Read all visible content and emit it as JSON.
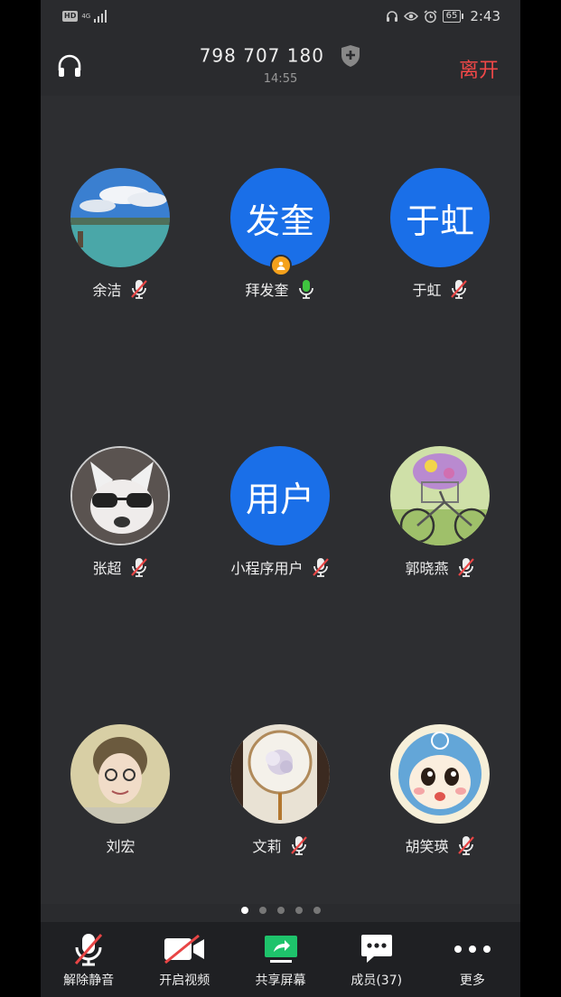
{
  "status_bar": {
    "hd": "HD",
    "network": "4G",
    "battery": "65",
    "time": "2:43"
  },
  "header": {
    "meeting_id": "798 707 180",
    "elapsed": "14:55",
    "leave_label": "离开"
  },
  "participants": [
    {
      "name": "余洁",
      "avatar_text": "",
      "mic": "muted"
    },
    {
      "name": "拜发奎",
      "avatar_text": "发奎",
      "mic": "active",
      "host": true
    },
    {
      "name": "于虹",
      "avatar_text": "于虹",
      "mic": "muted"
    },
    {
      "name": "张超",
      "avatar_text": "",
      "mic": "muted"
    },
    {
      "name": "小程序用户",
      "avatar_text": "用户",
      "mic": "muted"
    },
    {
      "name": "郭晓燕",
      "avatar_text": "",
      "mic": "muted"
    },
    {
      "name": "刘宏",
      "avatar_text": "",
      "mic": "none"
    },
    {
      "name": "文莉",
      "avatar_text": "",
      "mic": "muted"
    },
    {
      "name": "胡笑瑛",
      "avatar_text": "",
      "mic": "muted"
    }
  ],
  "pager": {
    "pages": 5,
    "current": 1
  },
  "toolbar": {
    "unmute_label": "解除静音",
    "video_label": "开启视频",
    "share_label": "共享屏幕",
    "members_label": "成员(37)",
    "more_label": "更多"
  },
  "colors": {
    "accent": "#1a6fe8",
    "leave": "#f04848",
    "mic_active": "#3fc53f",
    "host_badge": "#f4a11c",
    "share_green": "#1ec36b"
  }
}
